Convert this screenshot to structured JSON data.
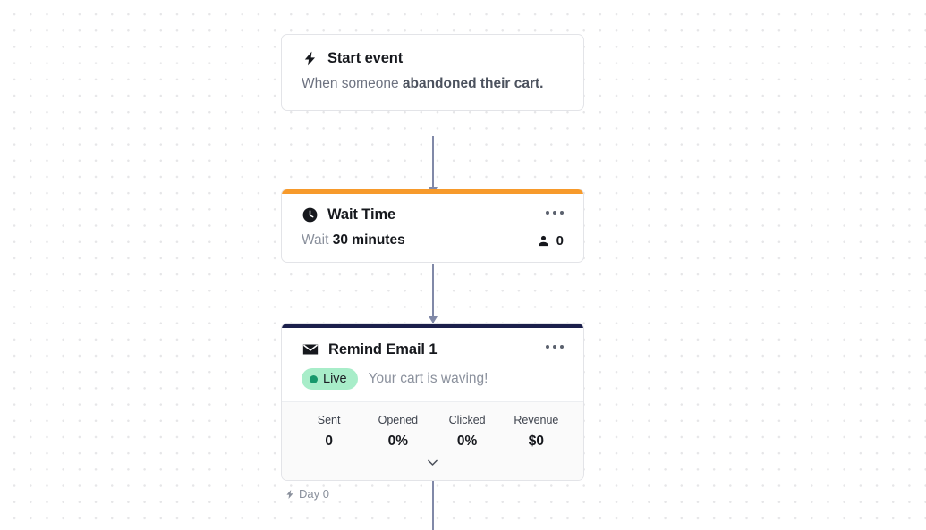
{
  "colors": {
    "wait_accent": "#f79a2b",
    "email_accent": "#1b1f4b",
    "live_badge_bg": "#a8edc9",
    "live_dot": "#17986b",
    "connector": "#8189a8"
  },
  "nodes": {
    "start": {
      "icon": "lightning-bolt-icon",
      "title": "Start event",
      "description_prefix": "When someone ",
      "description_strong": "abandoned their cart."
    },
    "wait": {
      "icon": "clock-icon",
      "title": "Wait Time",
      "menu_icon": "kebab-menu-icon",
      "wait_prefix": "Wait ",
      "wait_duration": "30 minutes",
      "contacts_icon": "person-icon",
      "contacts_count": "0"
    },
    "email": {
      "icon": "envelope-icon",
      "title": "Remind Email 1",
      "menu_icon": "kebab-menu-icon",
      "status_label": "Live",
      "subject": "Your cart is waving!",
      "stats": [
        {
          "label": "Sent",
          "value": "0"
        },
        {
          "label": "Opened",
          "value": "0%"
        },
        {
          "label": "Clicked",
          "value": "0%"
        },
        {
          "label": "Revenue",
          "value": "$0"
        }
      ],
      "expander_icon": "chevron-down-icon"
    }
  },
  "timeline": {
    "icon": "lightning-bolt-icon",
    "label": "Day 0"
  }
}
